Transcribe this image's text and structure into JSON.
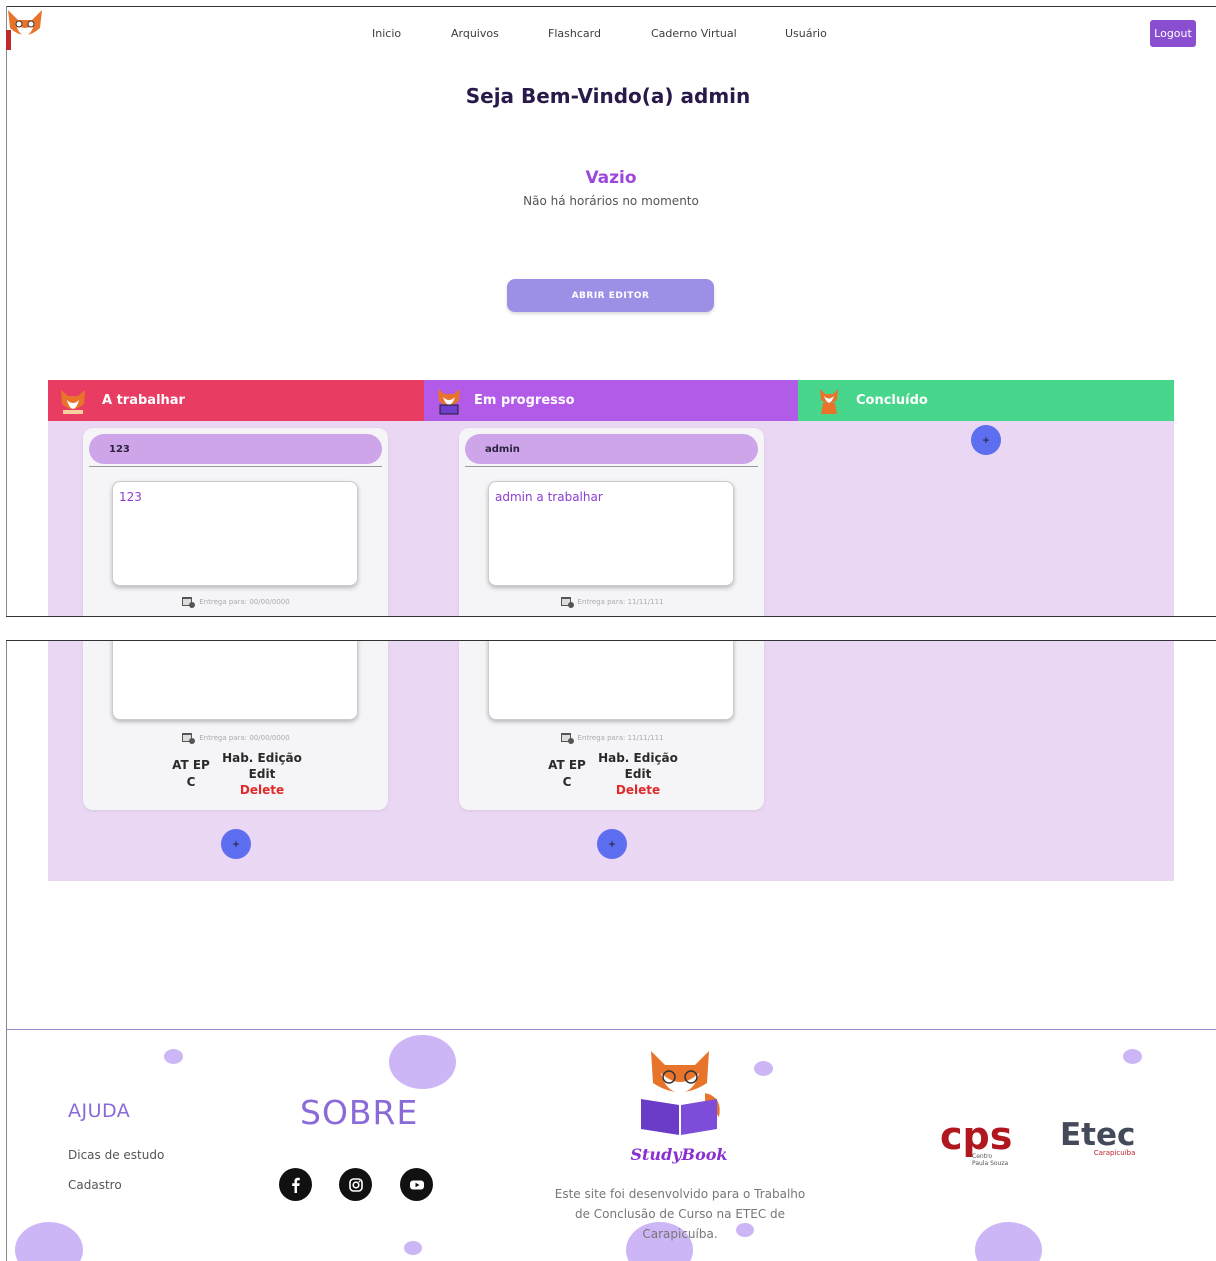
{
  "nav": {
    "links": [
      "Inicio",
      "Arquivos",
      "Flashcard",
      "Caderno Virtual",
      "Usuário"
    ],
    "logout": "Logout"
  },
  "welcome": "Seja Bem-Vindo(a) admin",
  "schedule": {
    "empty_title": "Vazio",
    "empty_message": "Não há horários no momento",
    "editor_button": "ABRIR EDITOR"
  },
  "board": {
    "columns": [
      {
        "title": "A trabalhar",
        "color": "#e83c62"
      },
      {
        "title": "Em progresso",
        "color": "#b25be8"
      },
      {
        "title": "Concluído",
        "color": "#48d68c"
      }
    ],
    "cards": [
      {
        "title": "123",
        "text": "123",
        "due": "Entrega para: 00/00/0000"
      },
      {
        "title": "admin",
        "text": "admin a trabalhar",
        "due": "Entrega para: 11/11/111"
      }
    ],
    "card_actions": {
      "atep_line1": "AT EP",
      "atep_line2": "C",
      "edit_toggle": "Hab. Edição",
      "edit": "Edit",
      "delete": "Delete"
    },
    "add_label": "+"
  },
  "footer": {
    "help_title": "AJUDA",
    "help_links": [
      "Dicas de estudo",
      "Cadastro"
    ],
    "about_title": "SOBRE",
    "social": [
      "facebook-icon",
      "instagram-icon",
      "youtube-icon"
    ],
    "brand": "StudyBook",
    "description": "Este site foi desenvolvido para o Trabalho de Conclusão de Curso na ETEC de Carapicuíba.",
    "logos": {
      "cps_line1": "Centro",
      "cps_line2": "Paula Souza",
      "etec": "Etec",
      "etec_sub": "Carapicuíba"
    }
  }
}
